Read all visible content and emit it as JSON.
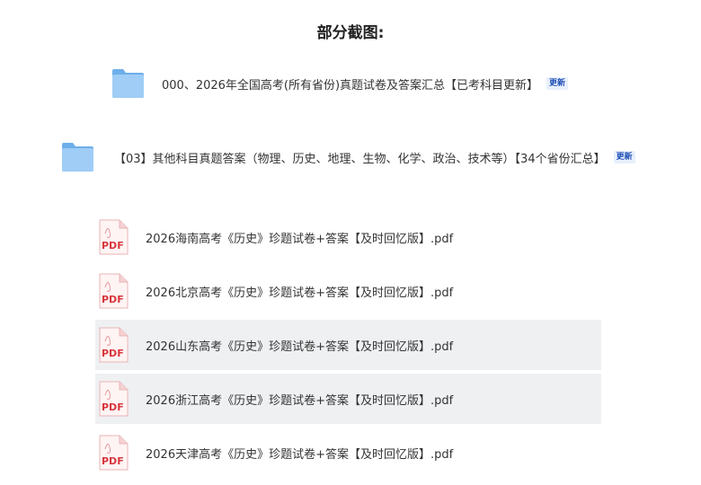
{
  "page_title": "部分截图:",
  "folders": [
    {
      "label": "000、2026年全国高考(所有省份)真题试卷及答案汇总【已考科目更新】",
      "badge": "更新"
    },
    {
      "label": "【03】其他科目真题答案（物理、历史、地理、生物、化学、政治、技术等）【34个省份汇总】",
      "badge": "更新"
    }
  ],
  "pdf_icon_text": "PDF",
  "files": [
    {
      "name": "2026海南高考《历史》珍题试卷+答案【及时回忆版】.pdf",
      "highlighted": false
    },
    {
      "name": "2026北京高考《历史》珍题试卷+答案【及时回忆版】.pdf",
      "highlighted": false
    },
    {
      "name": "2026山东高考《历史》珍题试卷+答案【及时回忆版】.pdf",
      "highlighted": true
    },
    {
      "name": "2026浙江高考《历史》珍题试卷+答案【及时回忆版】.pdf",
      "highlighted": true
    },
    {
      "name": "2026天津高考《历史》珍题试卷+答案【及时回忆版】.pdf",
      "highlighted": false
    }
  ],
  "colors": {
    "folder_blue": "#8fc3f3",
    "pdf_red": "#d9363e",
    "badge_blue": "#1e4fb5",
    "row_highlight": "#eff0f2"
  }
}
